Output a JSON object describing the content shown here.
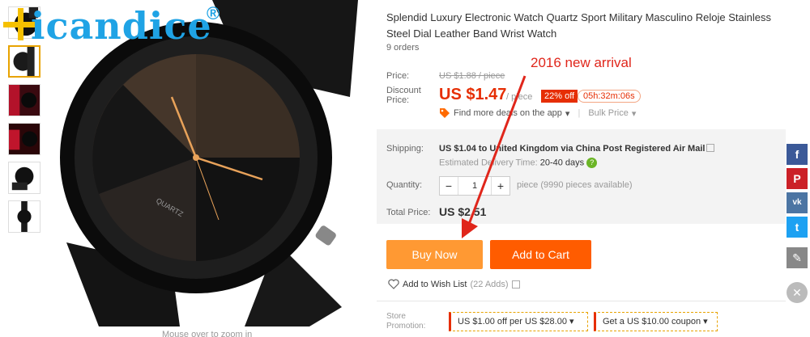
{
  "brand": {
    "name": "icandice",
    "registered": "®",
    "color": "#1fa3e5",
    "accent": "#f5c000"
  },
  "gallery": {
    "thumbnails": [
      "thumb-watch-1",
      "thumb-watch-2",
      "thumb-watch-3",
      "thumb-watch-4",
      "thumb-watch-5"
    ],
    "active_index": 0,
    "dial_text": "QUARTZ",
    "zoom_hint": "Mouse over to zoom in"
  },
  "product": {
    "title": "Splendid Luxury Electronic Watch Quartz Sport Military Masculino Reloje Stainless Steel Dial Leather Band Wrist Watch",
    "orders": "9 orders",
    "annotation": "2016 new arrival"
  },
  "price": {
    "label": "Price:",
    "original": "US $1.88 / piece",
    "discount_label": "Discount Price:",
    "discount": "US $1.47",
    "per_piece": "/ piece",
    "off_badge": "22% off",
    "countdown": "05h:32m:06s",
    "deals_link": "Find more deals on the app",
    "bulk_price": "Bulk Price"
  },
  "shipping": {
    "label": "Shipping:",
    "text": "US $1.04 to United Kingdom via China Post Registered Air Mail",
    "delivery_label": "Estimated Delivery Time:",
    "delivery_days": "20-40",
    "delivery_unit": "days"
  },
  "quantity": {
    "label": "Quantity:",
    "value": "1",
    "minus": "−",
    "plus": "+",
    "stock": "piece (9990 pieces available)"
  },
  "total": {
    "label": "Total Price:",
    "value": "US $2.51"
  },
  "actions": {
    "buy_now": "Buy Now",
    "add_to_cart": "Add to Cart"
  },
  "wishlist": {
    "label": "Add to Wish List",
    "count": "(22 Adds)"
  },
  "promotion": {
    "label": "Store Promotion:",
    "coupon1": "US $1.00 off per US $28.00",
    "coupon2": "Get a US $10.00 coupon"
  },
  "social": {
    "facebook": "f",
    "pinterest": "P",
    "vk": "vk",
    "twitter": "t",
    "icons": [
      "facebook-icon",
      "pinterest-icon",
      "vk-icon",
      "twitter-icon",
      "edit-icon"
    ],
    "close": "✕"
  },
  "colors": {
    "price_red": "#e62e04",
    "buy_now": "#ff9933",
    "add_to_cart": "#ff5c00",
    "arrow_red": "#e0261b"
  }
}
